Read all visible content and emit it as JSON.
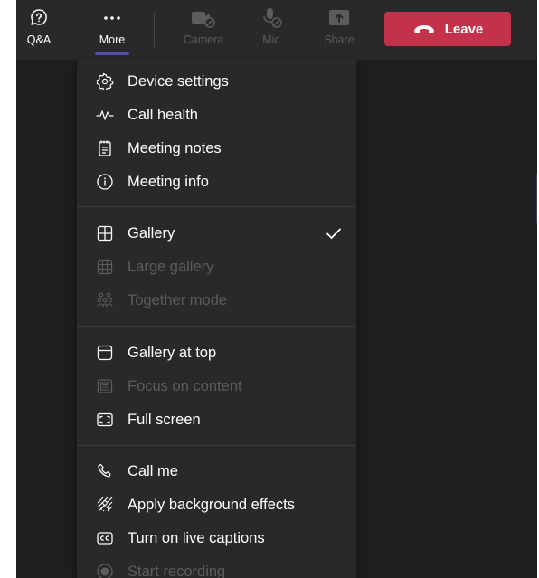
{
  "toolbar": {
    "qa_label": "Q&A",
    "more_label": "More",
    "camera_label": "Camera",
    "mic_label": "Mic",
    "share_label": "Share",
    "leave_label": "Leave",
    "colors": {
      "leave": "#c4314b",
      "accent": "#4f52b2"
    }
  },
  "menu": {
    "items": [
      {
        "label": "Device settings",
        "icon": "gear-icon",
        "enabled": true
      },
      {
        "label": "Call health",
        "icon": "pulse-icon",
        "enabled": true
      },
      {
        "label": "Meeting notes",
        "icon": "notes-icon",
        "enabled": true
      },
      {
        "label": "Meeting info",
        "icon": "info-icon",
        "enabled": true
      },
      {
        "label": "Gallery",
        "icon": "gallery-icon",
        "enabled": true,
        "checked": true
      },
      {
        "label": "Large gallery",
        "icon": "large-gallery-icon",
        "enabled": false
      },
      {
        "label": "Together mode",
        "icon": "together-mode-icon",
        "enabled": false
      },
      {
        "label": "Gallery at top",
        "icon": "gallery-top-icon",
        "enabled": true
      },
      {
        "label": "Focus on content",
        "icon": "focus-icon",
        "enabled": false
      },
      {
        "label": "Full screen",
        "icon": "fullscreen-icon",
        "enabled": true
      },
      {
        "label": "Call me",
        "icon": "phone-icon",
        "enabled": true
      },
      {
        "label": "Apply background effects",
        "icon": "background-effects-icon",
        "enabled": true
      },
      {
        "label": "Turn on live captions",
        "icon": "captions-icon",
        "enabled": true
      },
      {
        "label": "Start recording",
        "icon": "record-icon",
        "enabled": false
      }
    ]
  }
}
